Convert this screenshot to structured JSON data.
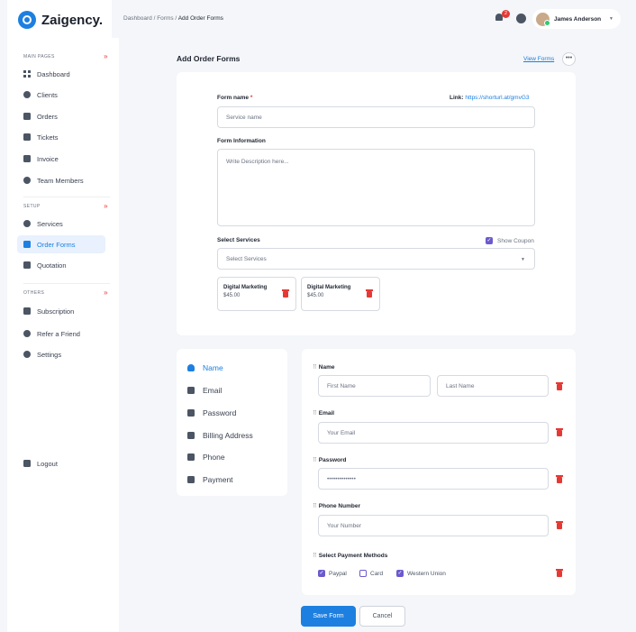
{
  "brand": {
    "name": "Zaigency."
  },
  "sidebar": {
    "sections": [
      {
        "title": "MAIN PAGES"
      },
      {
        "title": "SETUP"
      },
      {
        "title": "OTHERS"
      }
    ],
    "main_items": [
      {
        "label": "Dashboard",
        "icon": "grid-icon"
      },
      {
        "label": "Clients",
        "icon": "users-icon"
      },
      {
        "label": "Orders",
        "icon": "clipboard-icon"
      },
      {
        "label": "Tickets",
        "icon": "ticket-icon"
      },
      {
        "label": "Invoice",
        "icon": "invoice-icon"
      },
      {
        "label": "Team Members",
        "icon": "team-icon"
      }
    ],
    "setup_items": [
      {
        "label": "Services",
        "icon": "gear-icon"
      },
      {
        "label": "Order Forms",
        "icon": "form-icon",
        "active": true
      },
      {
        "label": "Quotation",
        "icon": "quote-icon"
      }
    ],
    "other_items": [
      {
        "label": "Subscription",
        "icon": "subscription-icon"
      },
      {
        "label": "Refer a Friend",
        "icon": "handshake-icon"
      },
      {
        "label": "Settings",
        "icon": "gear-icon"
      }
    ],
    "logout_label": "Logout"
  },
  "topbar": {
    "breadcrumb": "Dashboard / Forms / ",
    "breadcrumb_current": "Add Order Forms",
    "notification_count": "2",
    "user_name": "James Anderson"
  },
  "page": {
    "title": "Add Order Forms",
    "view_forms": "View Forms",
    "more": "•••"
  },
  "form": {
    "name_label": "Form name",
    "required_mark": "*",
    "link_label": "Link: ",
    "link_url": "https://shorturl.at/gmvG3",
    "name_placeholder": "Service name",
    "info_label": "Form Information",
    "info_placeholder": "Write Description here...",
    "services_label": "Select Services",
    "coupon_label": "Show Coupon",
    "services_placeholder": "Select Services",
    "selected_services": [
      {
        "name": "Digital Marketing",
        "price": "$45.00"
      },
      {
        "name": "Digital Marketing",
        "price": "$45.00"
      }
    ]
  },
  "field_types": [
    {
      "label": "Name",
      "active": true
    },
    {
      "label": "Email"
    },
    {
      "label": "Password"
    },
    {
      "label": "Billing Address"
    },
    {
      "label": "Phone"
    },
    {
      "label": "Payment"
    }
  ],
  "fields": {
    "name_label": "Name",
    "first_placeholder": "First Name",
    "last_placeholder": "Last Name",
    "email_label": "Email",
    "email_placeholder": "Your Email",
    "password_label": "Password",
    "password_value": "••••••••••••••",
    "phone_label": "Phone Number",
    "phone_placeholder": "Your Number",
    "payment_label": "Select Payment Methods",
    "payment_methods": [
      {
        "label": "Paypal",
        "checked": true
      },
      {
        "label": "Card",
        "checked": false
      },
      {
        "label": "Western Union",
        "checked": true
      }
    ]
  },
  "actions": {
    "save": "Save Form",
    "cancel": "Cancel"
  },
  "colors": {
    "accent": "#1d7fe0",
    "danger": "#e53935",
    "check": "#6a5acd"
  }
}
